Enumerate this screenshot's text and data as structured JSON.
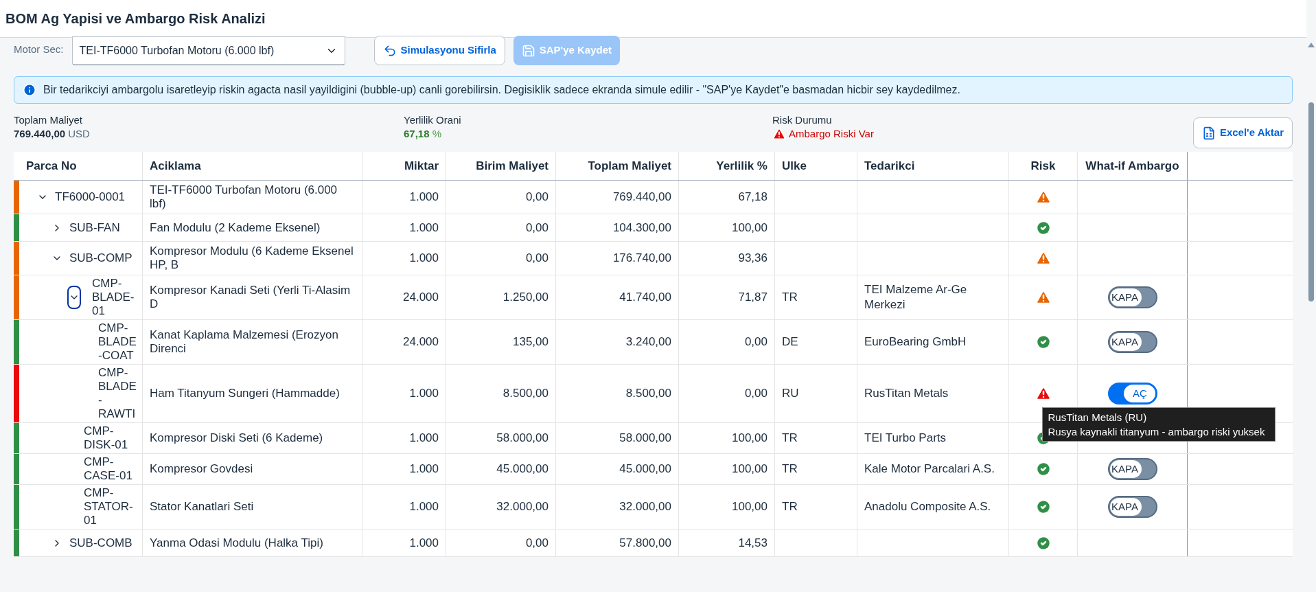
{
  "title": "BOM Ag Yapisi ve Ambargo Risk Analizi",
  "toolbar": {
    "motor_label": "Motor Sec:",
    "motor_value": "TEI-TF6000 Turbofan Motoru (6.000 lbf)",
    "reset_button": "Simulasyonu Sifirla",
    "save_button": {
      "label": "SAP'ye Kaydet",
      "disabled": true
    }
  },
  "info": "Bir tedarikciyi ambargolu isaretleyip riskin agacta nasil yayildigini (bubble-up) canli gorebilirsin. Degisiklik sadece ekranda simule edilir - \"SAP'ye Kaydet\"e basmadan hicbir sey kaydedilmez.",
  "summary": [
    {
      "kind": "cost",
      "label": "Toplam Maliyet",
      "value": "769.440,00",
      "unit": "USD"
    },
    {
      "kind": "ratio",
      "label": "Yerlilik Orani",
      "value": "67,18",
      "unit": "%"
    },
    {
      "kind": "risk",
      "label": "Risk Durumu",
      "value": "Ambargo Riski Var"
    }
  ],
  "export_button": "Excel'e Aktar",
  "table": {
    "columns": [
      "Parca No",
      "Aciklama",
      "Miktar",
      "Birim Maliyet",
      "Toplam Maliyet",
      "Yerlilik %",
      "Ulke",
      "Tedarikci",
      "Risk",
      "What-if Ambargo"
    ],
    "rows": [
      {
        "part_no": "TF6000-0001",
        "expanded": true,
        "focused": false,
        "description": "TEI-TF6000 Turbofan Motoru (6.000 lbf)",
        "quantity": "1.000",
        "unit_cost": "0,00",
        "total_cost": "769.440,00",
        "local_pct": "67,18",
        "kind": "warning",
        "color": "#e76500",
        "children": [
          {
            "part_no": "SUB-FAN",
            "expanded": false,
            "focused": false,
            "description": "Fan Modulu (2 Kademe Eksenel)",
            "quantity": "1.000",
            "unit_cost": "0,00",
            "total_cost": "104.300,00",
            "local_pct": "100,00",
            "kind": "ok",
            "color": "#2f8f47"
          },
          {
            "part_no": "SUB-COMP",
            "expanded": true,
            "focused": false,
            "description": "Kompresor Modulu (6 Kademe Eksenel HP, B",
            "quantity": "1.000",
            "unit_cost": "0,00",
            "total_cost": "176.740,00",
            "local_pct": "93,36",
            "kind": "warning",
            "color": "#e76500",
            "children": [
              {
                "part_no": "CMP-BLADE-01",
                "expanded": true,
                "focused": true,
                "description": "Kompresor Kanadi Seti (Yerli Ti-Alasim D",
                "quantity": "24.000",
                "unit_cost": "1.250,00",
                "total_cost": "41.740,00",
                "local_pct": "71,87",
                "country": "TR",
                "supplier": "TEI Malzeme Ar-Ge Merkezi",
                "kind": "warning",
                "color": "#e76500",
                "embargo": {
                  "on": false,
                  "label": "KAPA"
                },
                "children": [
                  {
                    "part_no": "CMP-BLADE-COAT",
                    "description": "Kanat Kaplama Malzemesi (Erozyon Direnci",
                    "quantity": "24.000",
                    "unit_cost": "135,00",
                    "total_cost": "3.240,00",
                    "local_pct": "0,00",
                    "country": "DE",
                    "supplier": "EuroBearing GmbH",
                    "kind": "ok",
                    "color": "#2f8f47",
                    "embargo": {
                      "on": false,
                      "label": "KAPA"
                    }
                  },
                  {
                    "part_no": "CMP-BLADE-RAWTI",
                    "description": "Ham Titanyum Sungeri (Hammadde)",
                    "quantity": "1.000",
                    "unit_cost": "8.500,00",
                    "total_cost": "8.500,00",
                    "local_pct": "0,00",
                    "country": "RU",
                    "supplier": "RusTitan Metals",
                    "kind": "critical",
                    "color": "#e90b0b",
                    "embargo": {
                      "on": true,
                      "label": "AÇ"
                    },
                    "tooltip": [
                      "RusTitan Metals (RU)",
                      "Rusya kaynakli titanyum - ambargo riski yuksek"
                    ]
                  }
                ]
              },
              {
                "part_no": "CMP-DISK-01",
                "description": "Kompresor Diski Seti (6 Kademe)",
                "quantity": "1.000",
                "unit_cost": "58.000,00",
                "total_cost": "58.000,00",
                "local_pct": "100,00",
                "country": "TR",
                "supplier": "TEI Turbo Parts",
                "kind": "ok",
                "color": "#2f8f47"
              },
              {
                "part_no": "CMP-CASE-01",
                "description": "Kompresor Govdesi",
                "quantity": "1.000",
                "unit_cost": "45.000,00",
                "total_cost": "45.000,00",
                "local_pct": "100,00",
                "country": "TR",
                "supplier": "Kale Motor Parcalari A.S.",
                "kind": "ok",
                "color": "#2f8f47",
                "embargo": {
                  "on": false,
                  "label": "KAPA"
                }
              },
              {
                "part_no": "CMP-STATOR-01",
                "description": "Stator Kanatlari Seti",
                "quantity": "1.000",
                "unit_cost": "32.000,00",
                "total_cost": "32.000,00",
                "local_pct": "100,00",
                "country": "TR",
                "supplier": "Anadolu Composite A.S.",
                "kind": "ok",
                "color": "#2f8f47",
                "embargo": {
                  "on": false,
                  "label": "KAPA"
                }
              }
            ]
          },
          {
            "part_no": "SUB-COMB",
            "expanded": false,
            "focused": false,
            "description": "Yanma Odasi Modulu (Halka Tipi)",
            "quantity": "1.000",
            "unit_cost": "0,00",
            "total_cost": "57.800,00",
            "local_pct": "14,53",
            "kind": "ok",
            "color": "#2f8f47"
          }
        ]
      }
    ]
  }
}
